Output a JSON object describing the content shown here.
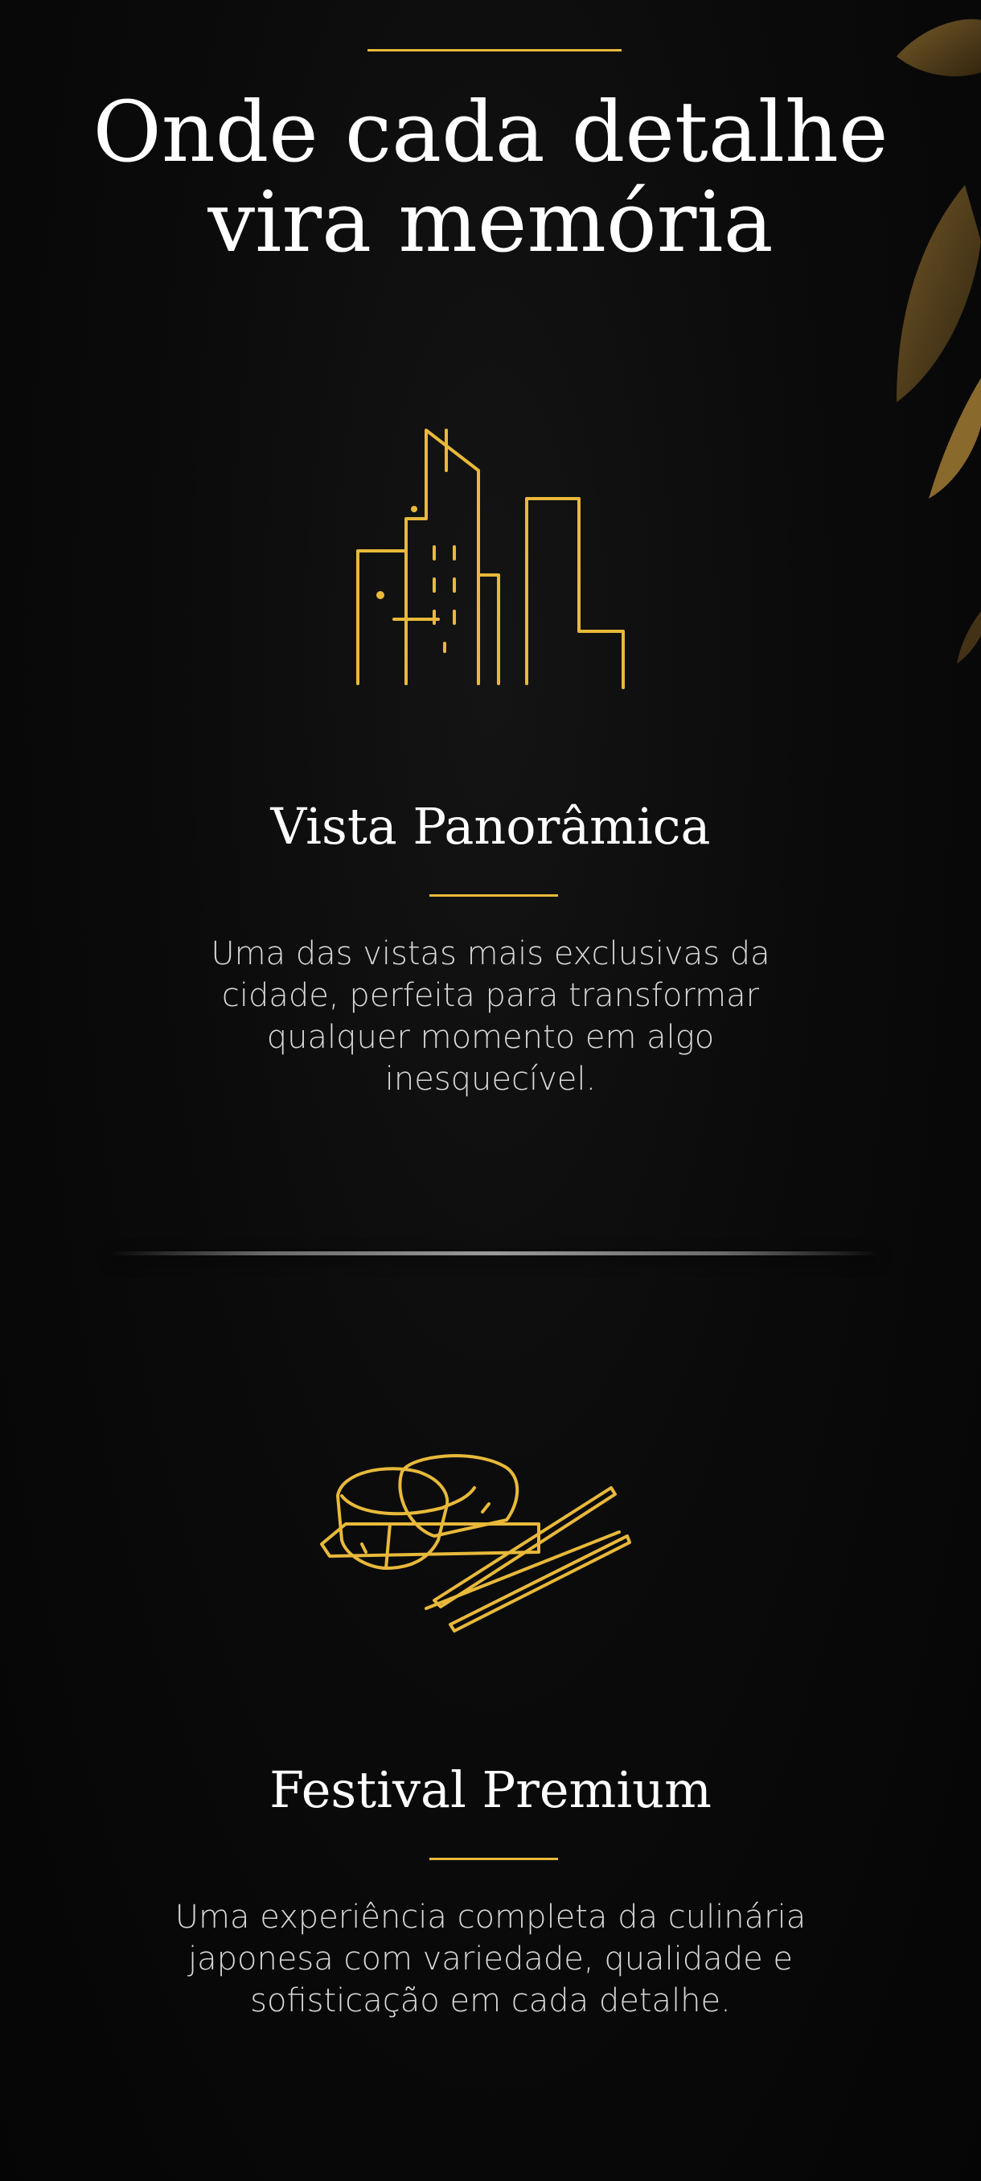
{
  "headline": {
    "line1": "Onde cada detalhe",
    "line2": "vira memória"
  },
  "features": [
    {
      "icon": "city-skyline-icon",
      "title": "Vista Panorâmica",
      "description": "Uma das vistas mais exclusivas da cidade, perfeita para transformar qualquer momento em algo inesquecível."
    },
    {
      "icon": "sushi-chopsticks-icon",
      "title": "Festival Premium",
      "description": "Uma experiência completa da culinária japonesa com variedade, qualidade e sofisticação em cada detalhe."
    }
  ],
  "colors": {
    "background": "#070707",
    "accent_gold": "#e8b93a",
    "text": "#ffffff"
  }
}
